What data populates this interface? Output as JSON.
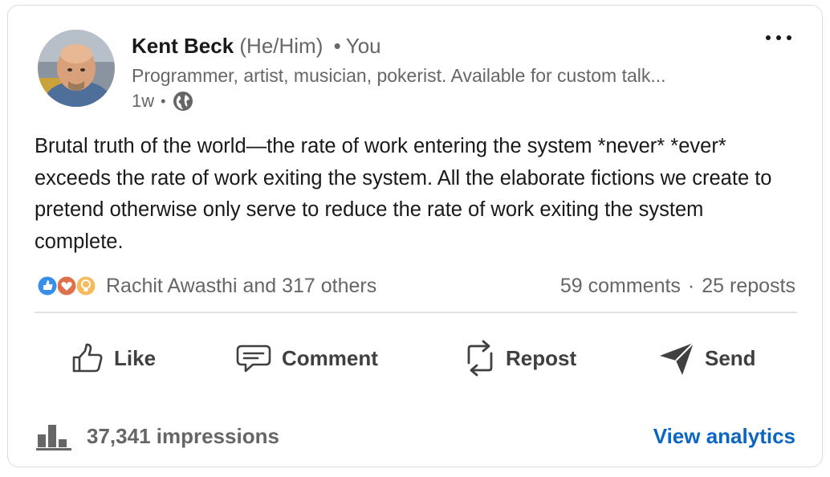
{
  "post": {
    "author": {
      "name": "Kent Beck",
      "pronouns": "(He/Him)",
      "separator": "•",
      "relation": "You",
      "headline": "Programmer, artist, musician, pokerist. Available for custom talk...",
      "time": "1w",
      "meta_separator": "•",
      "visibility_icon": "globe-icon"
    },
    "more_menu_icon": "three-dots-icon",
    "text": "Brutal truth of the world—the rate of work entering the system *never* *ever* exceeds the rate of work exiting the system. All the elaborate fictions we create to pretend otherwise only serve to reduce the rate of work exiting the system complete.",
    "reactions": {
      "icons": [
        "like-reaction-icon",
        "love-reaction-icon",
        "insightful-reaction-icon"
      ],
      "text": "Rachit Awasthi and 317 others"
    },
    "counts": {
      "comments": "59 comments",
      "separator": "·",
      "reposts": "25 reposts"
    },
    "actions": {
      "like": "Like",
      "comment": "Comment",
      "repost": "Repost",
      "send": "Send"
    },
    "footer": {
      "impressions": "37,341 impressions",
      "analytics_link": "View analytics"
    }
  },
  "colors": {
    "text_primary": "#191919",
    "text_secondary": "#666666",
    "link_blue": "#0a66c2",
    "like_blue": "#378fe9",
    "love_red": "#df704d",
    "insight_yellow": "#f5bb5c",
    "card_border": "#dcdcdc"
  }
}
